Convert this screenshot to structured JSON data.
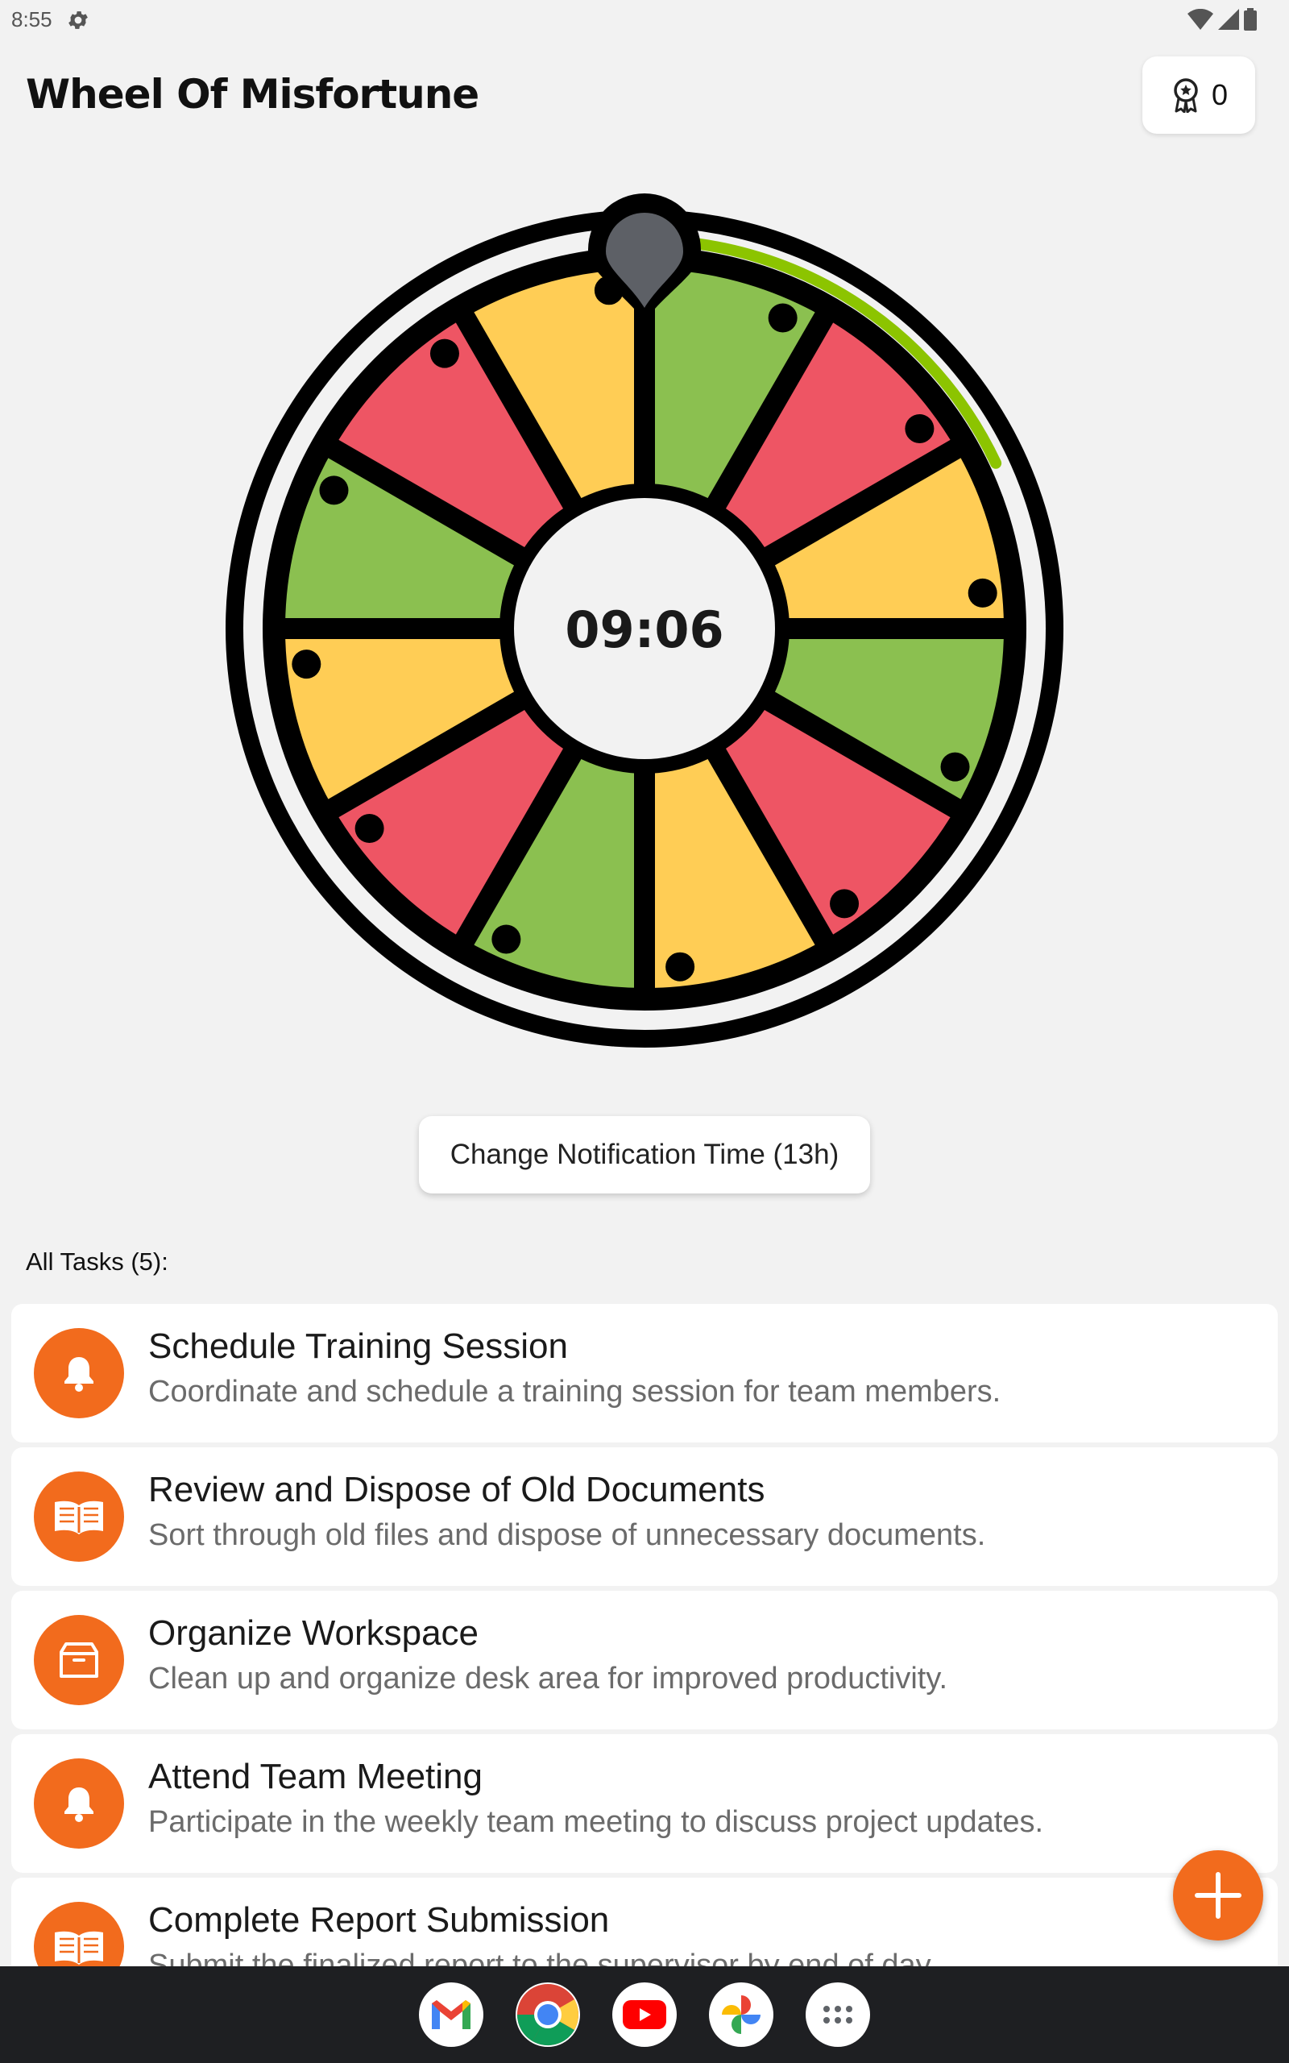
{
  "status_bar": {
    "time": "8:55"
  },
  "app": {
    "title": "Wheel Of Misfortune",
    "award_count": "0"
  },
  "wheel": {
    "center_time": "09:06",
    "progress_fraction": 0.18,
    "segment_colors": [
      "#8bc050",
      "#ee5564",
      "#ffcd55",
      "#8bc050",
      "#ee5564",
      "#ffcd55",
      "#8bc050",
      "#ee5564",
      "#ffcd55",
      "#8bc050",
      "#ee5564",
      "#ffcd55"
    ],
    "progress_color": "#8cc400",
    "pointer_color": "#5d6066"
  },
  "notification_button": {
    "label": "Change Notification Time (13h)"
  },
  "tasks": {
    "heading": "All Tasks (5):",
    "items": [
      {
        "icon": "bell-icon",
        "title": "Schedule Training Session",
        "description": "Coordinate and schedule a training session for team members."
      },
      {
        "icon": "book-icon",
        "title": "Review and Dispose of Old Documents",
        "description": "Sort through old files and dispose of unnecessary documents."
      },
      {
        "icon": "box-icon",
        "title": "Organize Workspace",
        "description": "Clean up and organize desk area for improved productivity."
      },
      {
        "icon": "bell-icon",
        "title": "Attend Team Meeting",
        "description": "Participate in the weekly team meeting to discuss project updates."
      },
      {
        "icon": "book-icon",
        "title": "Complete Report Submission",
        "description": "Submit the finalized report to the supervisor by end of day."
      }
    ]
  },
  "colors": {
    "accent": "#f26b1d",
    "background": "#f2f2f2"
  },
  "dock": {
    "apps": [
      {
        "name": "gmail-icon"
      },
      {
        "name": "chrome-icon"
      },
      {
        "name": "youtube-icon"
      },
      {
        "name": "photos-icon"
      },
      {
        "name": "app-drawer-icon"
      }
    ]
  }
}
